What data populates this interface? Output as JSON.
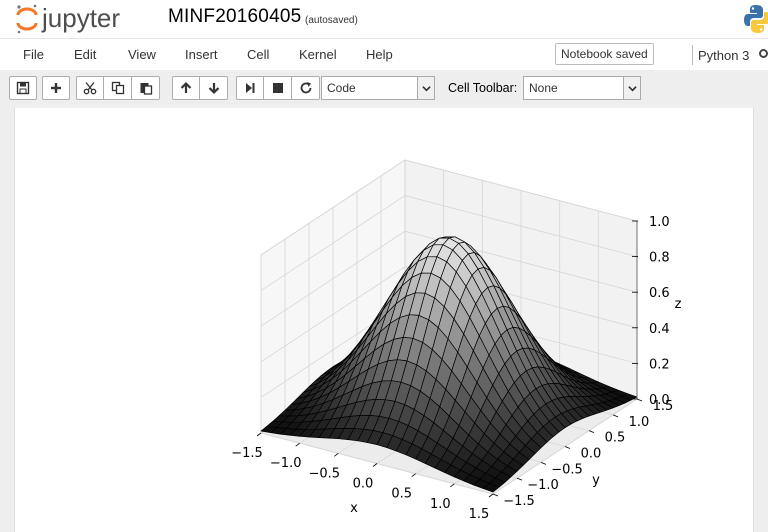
{
  "header": {
    "logo_text": "jupyter",
    "notebook_name": "MINF20160405",
    "autosave_status": "(autosaved)"
  },
  "menu": {
    "items": [
      "File",
      "Edit",
      "View",
      "Insert",
      "Cell",
      "Kernel",
      "Help"
    ],
    "status_badge": "Notebook saved",
    "kernel_name": "Python 3"
  },
  "toolbar": {
    "buttons": [
      "save-icon",
      "plus-icon",
      "cut-icon",
      "copy-icon",
      "paste-icon",
      "arrow-up-icon",
      "arrow-down-icon",
      "step-forward-icon",
      "stop-icon",
      "refresh-icon"
    ],
    "cell_type_value": "Code",
    "cell_toolbar_label": "Cell Toolbar:",
    "cell_toolbar_value": "None"
  },
  "output": {
    "chart_data": {
      "type": "surface",
      "title": "",
      "xlabel": "x",
      "ylabel": "y",
      "zlabel": "z",
      "xlim": [
        -1.5,
        1.5
      ],
      "ylim": [
        -1.5,
        1.5
      ],
      "zlim": [
        0.0,
        1.0
      ],
      "xticks": [
        "−1.5",
        "−1.0",
        "−0.5",
        "0.0",
        "0.5",
        "1.0",
        "1.5"
      ],
      "yticks": [
        "−1.5",
        "−1.0",
        "−0.5",
        "0.0",
        "0.5",
        "1.0",
        "1.5"
      ],
      "zticks": [
        "0.0",
        "0.2",
        "0.4",
        "0.6",
        "0.8",
        "1.0"
      ],
      "function": "z = exp(-(x^2 + y^2))",
      "peak": {
        "x": 0.0,
        "y": 0.0,
        "z": 1.0
      },
      "colormap": "gray",
      "grid": true
    }
  }
}
